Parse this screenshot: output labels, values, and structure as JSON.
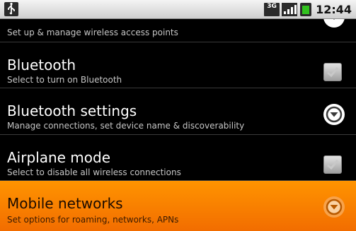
{
  "status_bar": {
    "network_label": "3G",
    "time": "12:44",
    "icons": [
      "usb-icon",
      "3g-icon",
      "signal-icon",
      "battery-icon"
    ]
  },
  "settings": {
    "items": [
      {
        "title": "",
        "summary": "Set up & manage wireless access points",
        "control": "chevron-down-icon"
      },
      {
        "title": "Bluetooth",
        "summary": "Select to turn on Bluetooth",
        "control": "checkbox"
      },
      {
        "title": "Bluetooth settings",
        "summary": "Manage connections, set device name & discoverability",
        "control": "chevron-down-icon"
      },
      {
        "title": "Airplane mode",
        "summary": "Select to disable all wireless connections",
        "control": "checkbox"
      },
      {
        "title": "Mobile networks",
        "summary": "Set options for roaming, networks, APNs",
        "control": "chevron-down-icon",
        "selected": true
      }
    ]
  },
  "colors": {
    "highlight": "#f58200",
    "background": "#000000",
    "battery": "#32c21f"
  }
}
